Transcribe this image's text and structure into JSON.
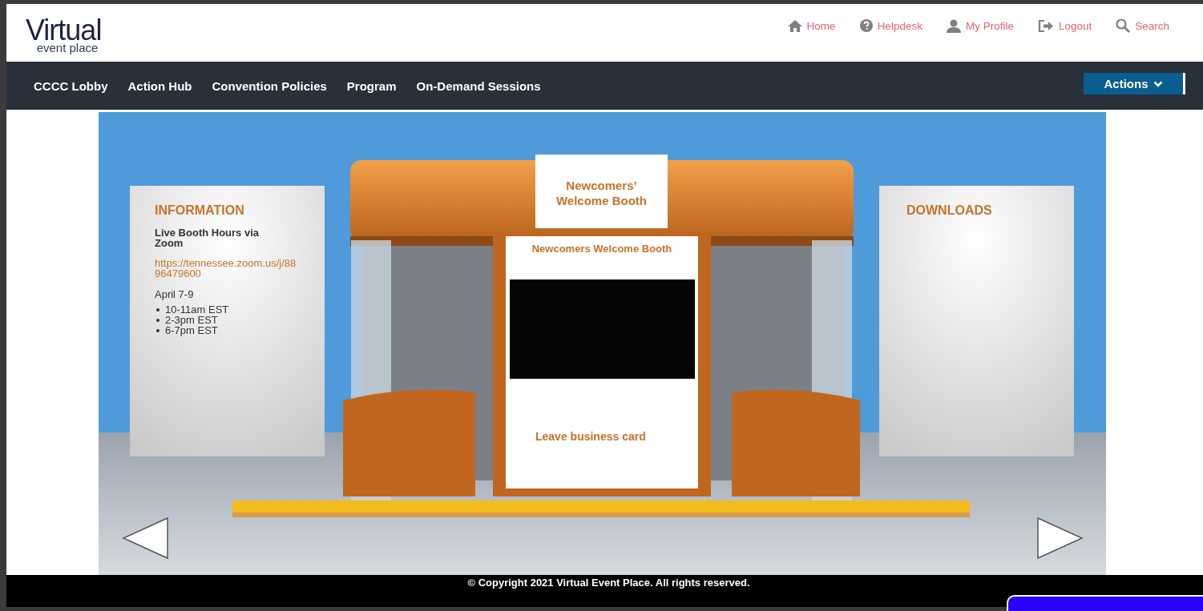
{
  "header": {
    "logo": {
      "title": "Virtual",
      "subtitle": "event place"
    },
    "links": [
      {
        "label": "Home",
        "kind": "home"
      },
      {
        "label": "Helpdesk",
        "kind": "help"
      },
      {
        "label": "My Profile",
        "kind": "user"
      },
      {
        "label": "Logout",
        "kind": "logout"
      },
      {
        "label": "Search",
        "kind": "search"
      }
    ]
  },
  "nav": {
    "items": [
      "CCCC Lobby",
      "Action Hub",
      "Convention Policies",
      "Program",
      "On-Demand Sessions"
    ],
    "actions_button": "Actions"
  },
  "booth": {
    "sign": "Newcomers’ Welcome Booth",
    "panel_title": "Newcomers Welcome Booth",
    "card_link": "Leave business card",
    "information": {
      "heading": "INFORMATION",
      "subheading": "Live Booth Hours via Zoom",
      "link": "https://tennessee.zoom.us/j/8896479600",
      "dates": "April 7-9",
      "times": [
        "10-11am EST",
        "2-3pm EST",
        "6-7pm EST"
      ]
    },
    "downloads": {
      "heading": "DOWNLOADS"
    }
  },
  "footer": {
    "copyright": "© Copyright 2021 Virtual Event Place. All rights reserved."
  }
}
